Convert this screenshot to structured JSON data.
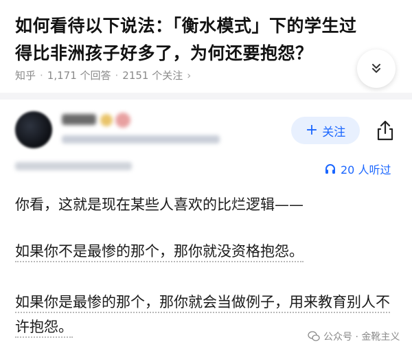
{
  "question": {
    "title": "如何看待以下说法：「衡水模式」下的学生过得比非洲孩子好多了，为何还要抱怨？",
    "source": "知乎",
    "answers_count": "1,171 个回答",
    "followers_count": "2151 个关注",
    "chevron": "›"
  },
  "answer": {
    "follow_label": "关注",
    "listened": "20 人听过",
    "paragraphs": [
      "你看，这就是现在某些人喜欢的比烂逻辑——",
      "如果你不是最惨的那个，那你就没资格抱怨。",
      "如果你是最惨的那个，那你就会当做例子，用来教育别人不许抱怨。"
    ]
  },
  "watermark": {
    "text": "公众号 · 金靴主义"
  },
  "colors": {
    "accent": "#1a66ff",
    "follow_bg": "#e8f0fe",
    "meta_gray": "#8a8a8a"
  },
  "icons": {
    "expand": "double-chevron-down-icon",
    "share": "share-icon",
    "headphones": "headphones-icon",
    "wechat": "wechat-icon"
  }
}
